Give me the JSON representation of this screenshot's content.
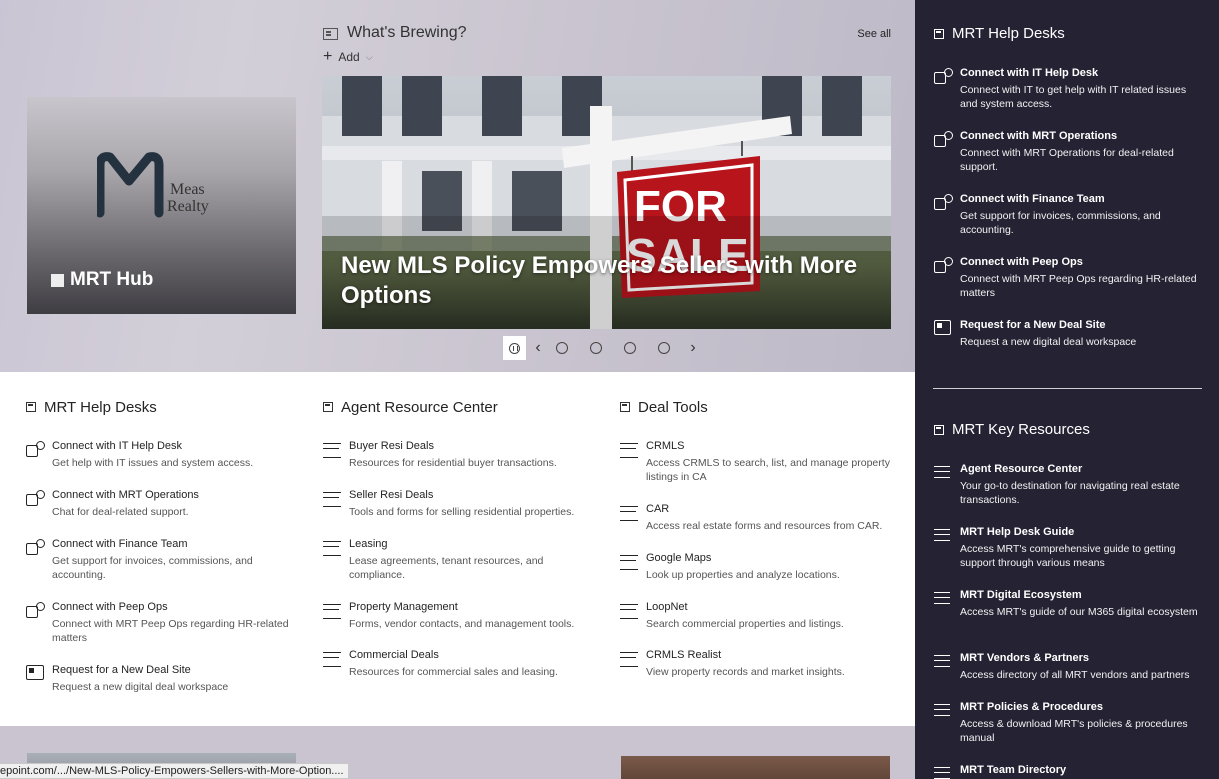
{
  "hub": {
    "title": "MRT Hub",
    "logo_text_1": "Meas",
    "logo_text_2": "Realty"
  },
  "news": {
    "title": "What's Brewing?",
    "see_all": "See all",
    "add_label": "Add",
    "slide_title": "New MLS Policy Empowers Sellers with More Options",
    "sign_text_1": "FOR",
    "sign_text_2": "SALE"
  },
  "help_desks": {
    "title": "MRT Help Desks",
    "items": [
      {
        "icon": "teams-icon",
        "title": "Connect with IT Help Desk",
        "desc": "Get help with IT issues and system access."
      },
      {
        "icon": "teams-icon",
        "title": "Connect with MRT Operations",
        "desc": "Chat for deal-related support."
      },
      {
        "icon": "teams-icon",
        "title": "Connect with Finance Team",
        "desc": "Get support for invoices, commissions, and accounting."
      },
      {
        "icon": "teams-icon",
        "title": "Connect with Peep Ops",
        "desc": "Connect with MRT Peep Ops regarding HR-related matters"
      },
      {
        "icon": "site-icon",
        "title": "Request for a New Deal Site",
        "desc": "Request a new digital deal workspace"
      }
    ]
  },
  "agent_center": {
    "title": "Agent Resource Center",
    "items": [
      {
        "icon": "list-icon",
        "title": "Buyer Resi Deals",
        "desc": "Resources for residential buyer transactions."
      },
      {
        "icon": "list-icon",
        "title": "Seller Resi Deals",
        "desc": "Tools and forms for selling residential properties."
      },
      {
        "icon": "list-icon",
        "title": "Leasing",
        "desc": "Lease agreements, tenant resources, and compliance."
      },
      {
        "icon": "list-icon",
        "title": "Property Management",
        "desc": "Forms, vendor contacts, and management tools."
      },
      {
        "icon": "list-icon",
        "title": "Commercial Deals",
        "desc": "Resources for commercial sales and leasing."
      }
    ]
  },
  "deal_tools": {
    "title": "Deal Tools",
    "items": [
      {
        "icon": "list-icon",
        "title": "CRMLS",
        "desc": "Access CRMLS to search, list, and manage property listings in CA"
      },
      {
        "icon": "list-icon",
        "title": "CAR",
        "desc": "Access real estate forms and resources from CAR."
      },
      {
        "icon": "list-icon",
        "title": "Google Maps",
        "desc": "Look up properties and analyze locations."
      },
      {
        "icon": "list-icon",
        "title": "LoopNet",
        "desc": "Search commercial properties and listings."
      },
      {
        "icon": "list-icon",
        "title": "CRMLS Realist",
        "desc": "View property records and market insights."
      }
    ]
  },
  "side_help_desks": {
    "title": "MRT Help Desks",
    "items": [
      {
        "icon": "teams-icon",
        "title": "Connect with IT Help Desk",
        "desc": "Connect with IT to get help with IT related issues and system access."
      },
      {
        "icon": "teams-icon",
        "title": "Connect with MRT Operations",
        "desc": "Connect with MRT Operations for deal-related support."
      },
      {
        "icon": "teams-icon",
        "title": "Connect with Finance Team",
        "desc": "Get support for invoices, commissions, and accounting."
      },
      {
        "icon": "teams-icon",
        "title": "Connect with Peep Ops",
        "desc": "Connect with MRT Peep Ops regarding HR-related matters"
      },
      {
        "icon": "site-icon",
        "title": "Request for a New Deal Site",
        "desc": "Request a new digital deal workspace"
      }
    ]
  },
  "side_key_resources": {
    "title": "MRT Key Resources",
    "items": [
      {
        "icon": "list-icon",
        "title": "Agent Resource Center",
        "desc": "Your go-to destination for navigating real estate transactions."
      },
      {
        "icon": "list-icon",
        "title": "MRT Help Desk Guide",
        "desc": "Access MRT's comprehensive guide to getting support through various means"
      },
      {
        "icon": "list-icon",
        "title": "MRT Digital Ecosystem",
        "desc": "Access MRT's guide of our M365 digital ecosystem"
      },
      {
        "icon": "list-icon",
        "title": "MRT Vendors & Partners",
        "desc": "Access directory of all MRT vendors and partners"
      },
      {
        "icon": "list-icon",
        "title": "MRT Policies & Procedures",
        "desc": "Access & download MRT's policies & procedures manual"
      },
      {
        "icon": "list-icon",
        "title": "MRT Team Directory",
        "desc": ""
      }
    ]
  },
  "status_bar": {
    "url": "epoint.com/.../New-MLS-Policy-Empowers-Sellers-with-More-Option...."
  },
  "colors": {
    "side_panel_bg": "#252233",
    "hero_bg": "#cac5d4",
    "sign_red": "#b8141c"
  }
}
